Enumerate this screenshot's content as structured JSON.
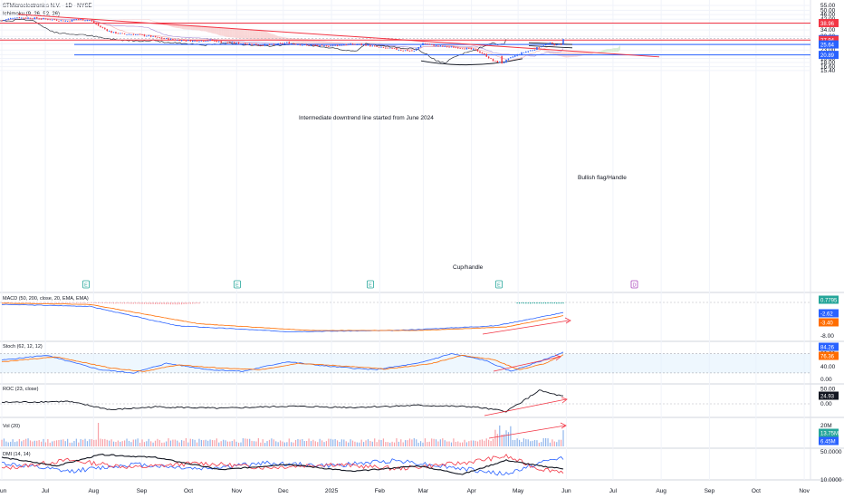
{
  "header": {
    "symbol": "STMicroelectronics N.V. · 1D · NYSE",
    "indicator": "Ichimoku (9, 26, 52, 26)"
  },
  "colors": {
    "up": "#2962ff",
    "down": "#f23645",
    "trend": "#f23645",
    "support": "#2962ff",
    "cloud_bear": "#f7c9c9",
    "cloud_bull": "#cfe9c9",
    "macd_line": "#2962ff",
    "signal_line": "#ff6d00",
    "stoch_k": "#2962ff",
    "stoch_d": "#ff6d00",
    "roc": "#131722",
    "dmi_plus": "#2962ff",
    "dmi_minus": "#f23645",
    "adx": "#131722"
  },
  "chart_data": [
    {
      "type": "candlestick",
      "pane": "price",
      "title": "STMicroelectronics N.V. · 1D · NYSE",
      "y_ticks": [
        "55.00",
        "50.00",
        "46.00",
        "42.00",
        "38.00",
        "34.00",
        "30.00",
        "26.00",
        "23.00",
        "21.00",
        "19.50",
        "18.00",
        "16.60",
        "15.40"
      ],
      "x_ticks": [
        "Jun",
        "Jul",
        "Aug",
        "Sep",
        "Oct",
        "Nov",
        "Dec",
        "2025",
        "Feb",
        "Mar",
        "Apr",
        "May",
        "Jun",
        "Jul",
        "Aug",
        "Sep",
        "Oct",
        "Nov"
      ],
      "price_labels": [
        {
          "value": "38.96",
          "color": "#f23645"
        },
        {
          "value": "28.41",
          "color": "#2962ff"
        },
        {
          "value": "27.94",
          "color": "#f23645"
        },
        {
          "value": "25.64",
          "color": "#2962ff"
        },
        {
          "value": "20.89",
          "color": "#2962ff"
        }
      ],
      "annotations": [
        {
          "text": "Intermediate downtrend line started from June 2024"
        },
        {
          "text": "Bullish flag/Handle"
        },
        {
          "text": "Cup/handle"
        }
      ],
      "event_markers": [
        "E",
        "E",
        "E",
        "E",
        "E"
      ],
      "dividend_marker": "D",
      "price_points": [
        {
          "x": "Jun",
          "y": 44.0
        },
        {
          "x": "Jul",
          "y": 41.5
        },
        {
          "x": "Aug",
          "y": 32.0
        },
        {
          "x": "Sep",
          "y": 30.0
        },
        {
          "x": "Oct",
          "y": 28.0
        },
        {
          "x": "Nov",
          "y": 26.5
        },
        {
          "x": "Dec",
          "y": 25.5
        },
        {
          "x": "2025",
          "y": 25.0
        },
        {
          "x": "Feb",
          "y": 24.5
        },
        {
          "x": "Mar",
          "y": 23.0
        },
        {
          "x": "Apr",
          "y": 18.5
        },
        {
          "x": "May",
          "y": 24.5
        },
        {
          "x": "Jun",
          "y": 28.41
        }
      ],
      "horizontal_levels": [
        38.96,
        27.94,
        25.64,
        20.89
      ]
    },
    {
      "type": "line",
      "pane": "macd",
      "title": "MACD (50, 200, close, 20, EMA, EMA)",
      "y_ticks": [
        "-8.00"
      ],
      "values_labels": [
        {
          "value": "0.7795",
          "color": "#26a69a"
        },
        {
          "value": "-2.62",
          "color": "#2962ff"
        },
        {
          "value": "-3.40",
          "color": "#ff6d00"
        }
      ]
    },
    {
      "type": "line",
      "pane": "stoch",
      "title": "Stoch (62, 12, 12)",
      "y_ticks": [
        "80.00",
        "40.00",
        "0.00"
      ],
      "values_labels": [
        {
          "value": "84.26",
          "color": "#2962ff"
        },
        {
          "value": "76.36",
          "color": "#ff6d00"
        }
      ]
    },
    {
      "type": "line",
      "pane": "roc",
      "title": "ROC (23, close)",
      "y_ticks": [
        "50.00",
        "0.00"
      ],
      "values_labels": [
        {
          "value": "24.93",
          "color": "#131722"
        }
      ]
    },
    {
      "type": "bar",
      "pane": "volume",
      "title": "Vol (20)",
      "y_ticks": [
        "20M"
      ],
      "values_labels": [
        {
          "value": "13.75M",
          "color": "#26a69a"
        },
        {
          "value": "6.45M",
          "color": "#2962ff"
        }
      ]
    },
    {
      "type": "line",
      "pane": "dmi",
      "title": "DMI (14, 14)",
      "y_ticks": [
        "50.0000",
        "10.0000"
      ]
    }
  ]
}
